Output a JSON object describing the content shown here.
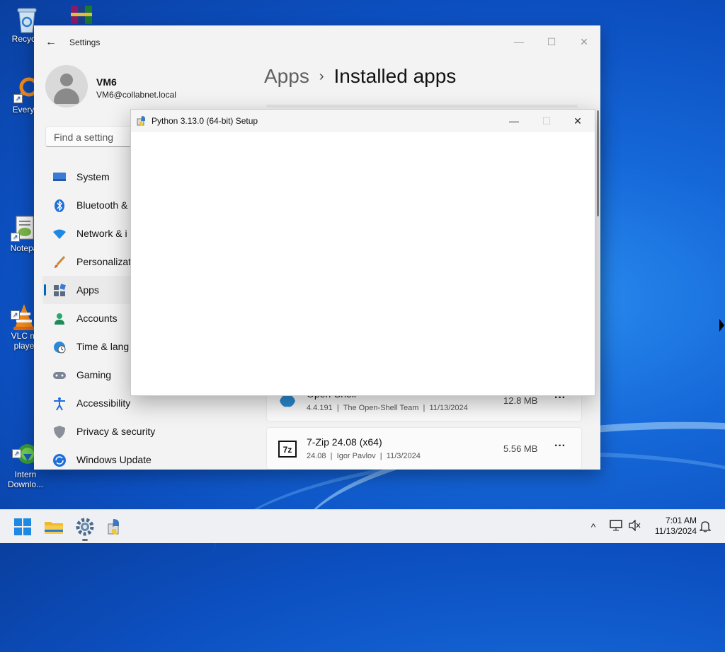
{
  "desktop": {
    "icons": [
      {
        "label": "Recycle",
        "icon": "recycle-bin-icon"
      },
      {
        "label": "Everyth",
        "icon": "everything-search-icon"
      },
      {
        "label": "Notepa",
        "icon": "notepad-plus-icon"
      },
      {
        "label": "VLC m\nplaye",
        "icon": "vlc-icon"
      },
      {
        "label": "Intern\nDownlo...",
        "icon": "internet-download-manager-icon"
      }
    ]
  },
  "settings": {
    "title": "Settings",
    "user": {
      "name": "VM6",
      "email": "VM6@collabnet.local"
    },
    "search_placeholder": "Find a setting",
    "nav": [
      {
        "label": "System",
        "icon": "monitor-icon"
      },
      {
        "label": "Bluetooth &",
        "icon": "bluetooth-icon"
      },
      {
        "label": "Network & i",
        "icon": "wifi-icon"
      },
      {
        "label": "Personalizati",
        "icon": "paintbrush-icon"
      },
      {
        "label": "Apps",
        "icon": "apps-icon",
        "active": true
      },
      {
        "label": "Accounts",
        "icon": "person-icon"
      },
      {
        "label": "Time & lang",
        "icon": "globe-clock-icon"
      },
      {
        "label": "Gaming",
        "icon": "gamepad-icon"
      },
      {
        "label": "Accessibility",
        "icon": "accessibility-icon"
      },
      {
        "label": "Privacy & security",
        "icon": "shield-icon"
      },
      {
        "label": "Windows Update",
        "icon": "windows-update-icon"
      }
    ],
    "breadcrumb": {
      "parent": "Apps",
      "separator": "›",
      "current": "Installed apps"
    },
    "apps": [
      {
        "name": "Open-Shell",
        "version": "4.4.191",
        "publisher": "The Open-Shell Team",
        "date": "11/13/2024",
        "size": "12.8 MB",
        "icon": "open-shell-icon"
      },
      {
        "name": "7-Zip 24.08 (x64)",
        "version": "24.08",
        "publisher": "Igor Pavlov",
        "date": "11/3/2024",
        "size": "5.56 MB",
        "icon": "7zip-icon"
      }
    ],
    "meta_separator": "|",
    "more_label": "···"
  },
  "dialog": {
    "title": "Python 3.13.0 (64-bit) Setup",
    "minimize": "—",
    "maximize": "☐",
    "close": "✕"
  },
  "window_controls": {
    "minimize": "—",
    "maximize": "☐",
    "close": "✕"
  },
  "taskbar": {
    "time": "7:01 AM",
    "date": "11/13/2024"
  },
  "colors": {
    "accent": "#0067c0",
    "desktop": "#1567d8"
  }
}
